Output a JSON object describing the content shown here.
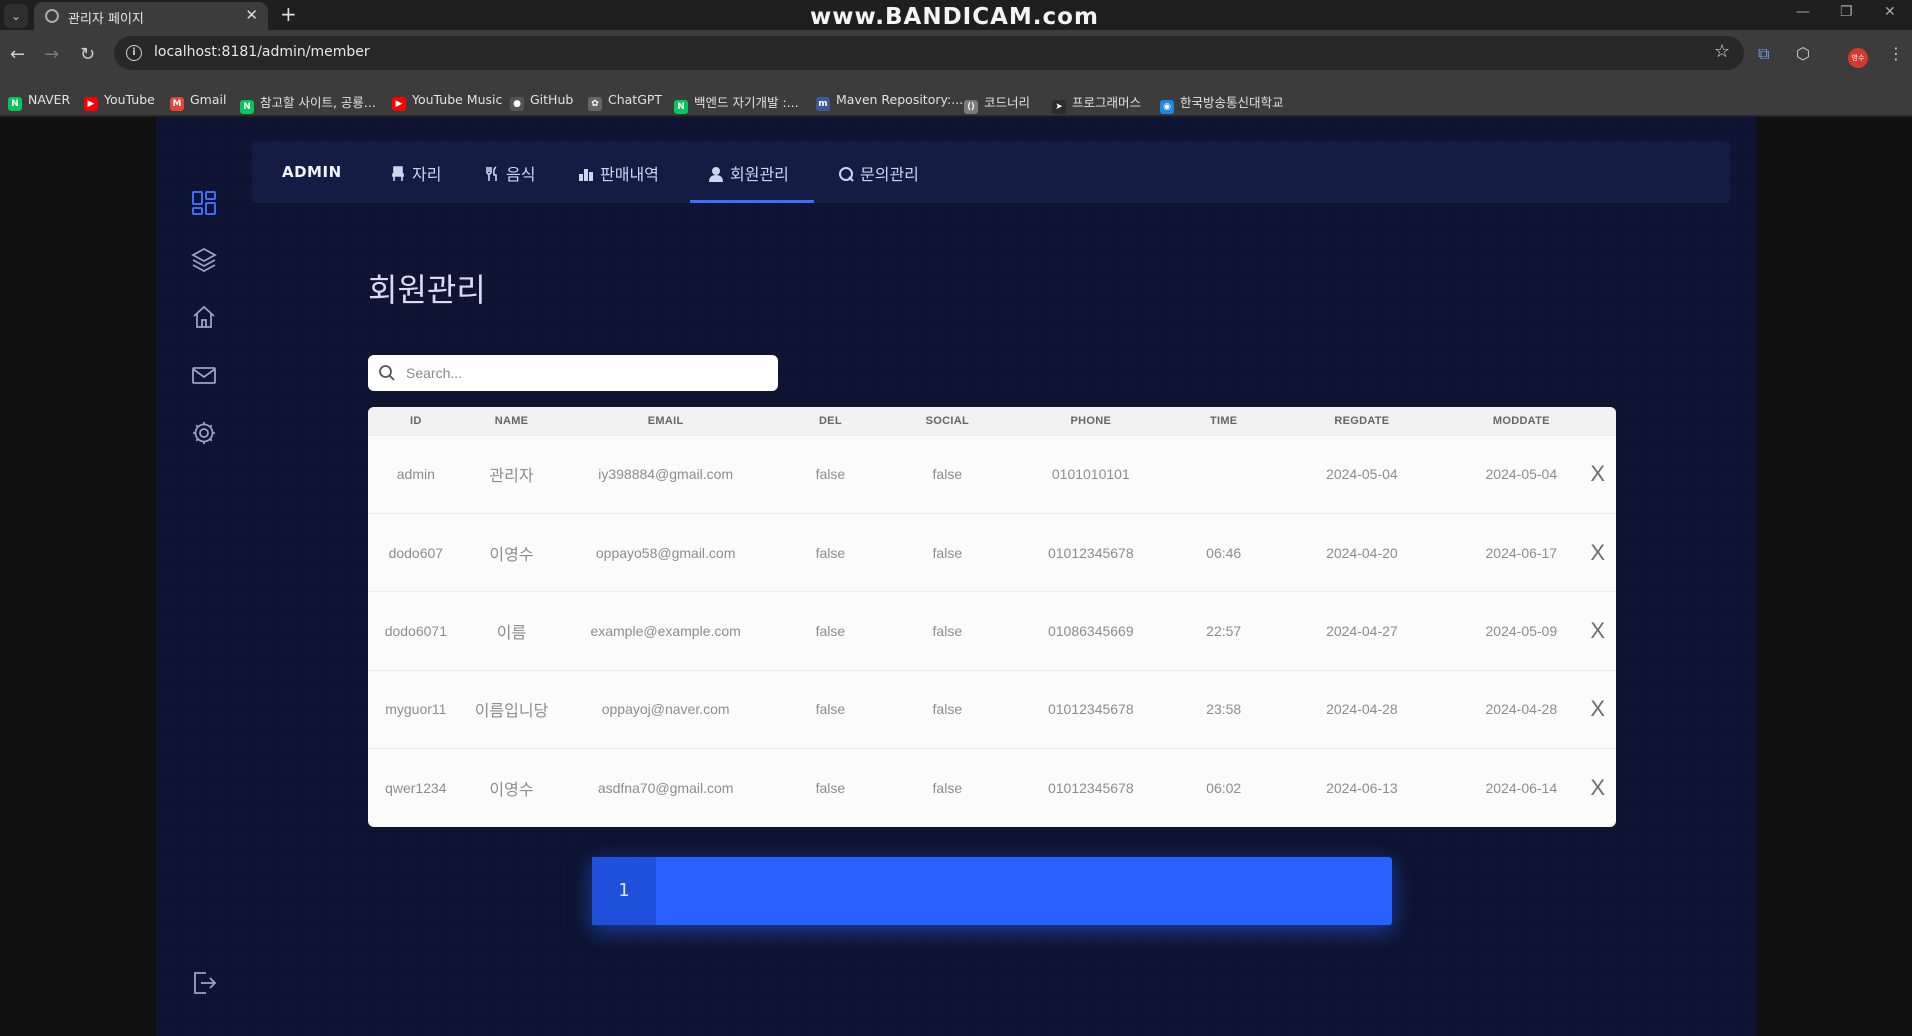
{
  "browser": {
    "tab_title": "관리자 페이지",
    "watermark": "www.BANDICAM.com",
    "url": "localhost:8181/admin/member",
    "profile_label": "영수",
    "bookmarks": [
      {
        "label": "NAVER",
        "color": "#03c75a",
        "glyph": "N"
      },
      {
        "label": "YouTube",
        "color": "#ff0000",
        "glyph": "▶"
      },
      {
        "label": "Gmail",
        "color": "#ea4335",
        "glyph": "M"
      },
      {
        "label": "참고할 사이트, 공룡...",
        "color": "#03c75a",
        "glyph": "N"
      },
      {
        "label": "YouTube Music",
        "color": "#ff0000",
        "glyph": "▶"
      },
      {
        "label": "GitHub",
        "color": "#555555",
        "glyph": "●"
      },
      {
        "label": "ChatGPT",
        "color": "#666666",
        "glyph": "✿"
      },
      {
        "label": "백엔드 자기개발 :...",
        "color": "#03c75a",
        "glyph": "N"
      },
      {
        "label": "Maven Repository:...",
        "color": "#3b5998",
        "glyph": "m"
      },
      {
        "label": "코드너리",
        "color": "#7a7a7a",
        "glyph": "⟨⟩"
      },
      {
        "label": "프로그래머스",
        "color": "#2b2b2b",
        "glyph": "➤"
      },
      {
        "label": "한국방송통신대학교",
        "color": "#1e88e5",
        "glyph": "◉"
      }
    ]
  },
  "nav": {
    "brand": "ADMIN",
    "items": [
      {
        "label": "자리",
        "icon": "chair-icon"
      },
      {
        "label": "음식",
        "icon": "utensils-icon"
      },
      {
        "label": "판매내역",
        "icon": "bar-chart-icon"
      },
      {
        "label": "회원관리",
        "icon": "user-icon",
        "active": true
      },
      {
        "label": "문의관리",
        "icon": "question-icon"
      }
    ]
  },
  "main": {
    "title": "회원관리",
    "search_placeholder": "Search..."
  },
  "table": {
    "columns": [
      "ID",
      "NAME",
      "EMAIL",
      "DEL",
      "SOCIAL",
      "PHONE",
      "TIME",
      "REGDATE",
      "MODDATE"
    ],
    "rows": [
      [
        "admin",
        "관리자",
        "iy398884@gmail.com",
        "false",
        "false",
        "0101010101",
        "",
        "2024-05-04",
        "2024-05-04"
      ],
      [
        "dodo607",
        "이영수",
        "oppayo58@gmail.com",
        "false",
        "false",
        "01012345678",
        "06:46",
        "2024-04-20",
        "2024-06-17"
      ],
      [
        "dodo6071",
        "이름",
        "example@example.com",
        "false",
        "false",
        "01086345669",
        "22:57",
        "2024-04-27",
        "2024-05-09"
      ],
      [
        "myguor11",
        "이름입니당",
        "oppayoj@naver.com",
        "false",
        "false",
        "01012345678",
        "23:58",
        "2024-04-28",
        "2024-04-28"
      ],
      [
        "qwer1234",
        "이영수",
        "asdfna70@gmail.com",
        "false",
        "false",
        "01012345678",
        "06:02",
        "2024-06-13",
        "2024-06-14"
      ]
    ],
    "delete_label": "X"
  },
  "pagination": {
    "current": "1"
  },
  "colors": {
    "accent": "#2961ff",
    "app_bg": "#0c1230",
    "nav_bg": "#141c44"
  }
}
